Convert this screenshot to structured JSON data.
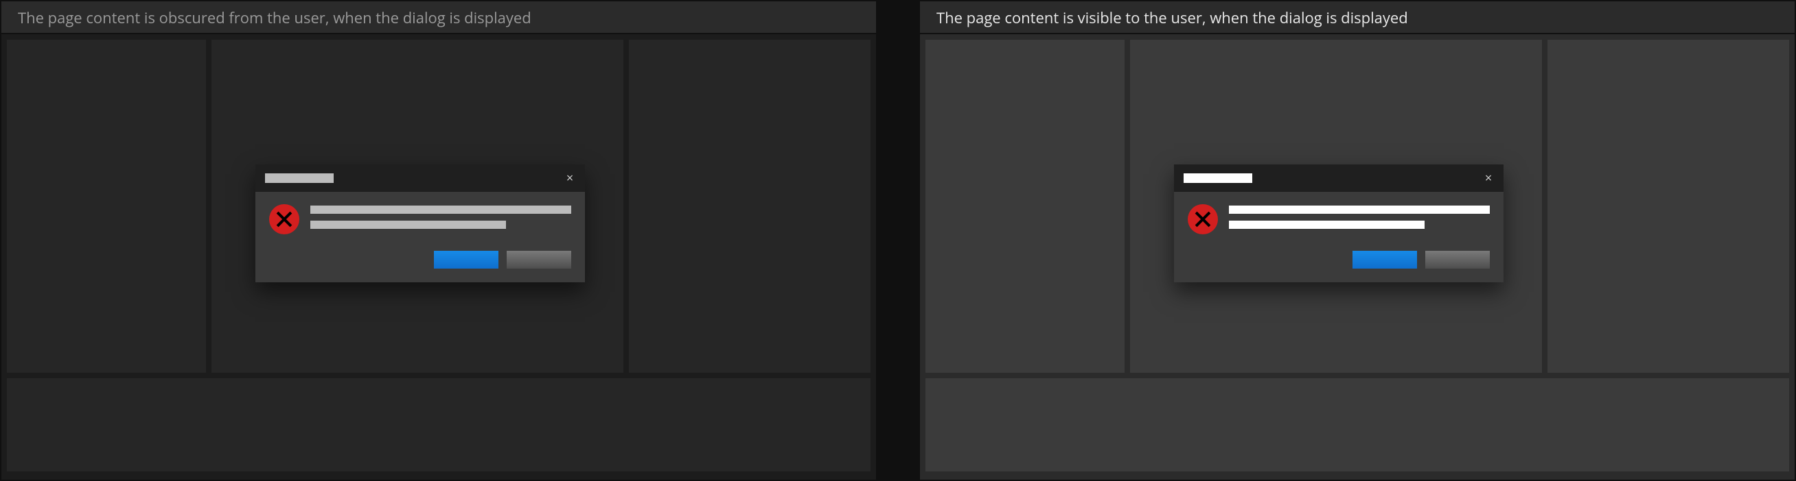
{
  "examples": {
    "obscured": {
      "caption": "The page content is obscured from the user, when the dialog is displayed"
    },
    "visible": {
      "caption": "The page content is visible to the user, when the dialog is displayed"
    }
  },
  "dialog": {
    "close_glyph": "×",
    "icon": "error-icon",
    "buttons": {
      "primary_label": "",
      "secondary_label": ""
    }
  }
}
